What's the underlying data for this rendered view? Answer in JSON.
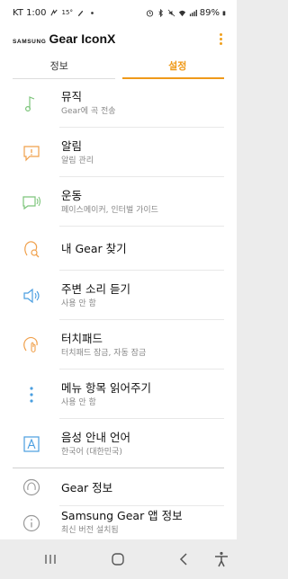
{
  "status": {
    "carrier_time": "KT 1:00",
    "temp": "15°",
    "battery": "89%"
  },
  "app": {
    "brand_small": "SAMSUNG",
    "brand_big": "Gear IconX"
  },
  "tabs": [
    {
      "label": "정보",
      "active": false
    },
    {
      "label": "설정",
      "active": true
    }
  ],
  "settings": [
    {
      "title": "뮤직",
      "subtitle": "Gear에 곡 전송",
      "icon": "music-note-icon"
    },
    {
      "title": "알림",
      "subtitle": "알림 관리",
      "icon": "notification-icon"
    },
    {
      "title": "운동",
      "subtitle": "페이스메이커, 인터벌 가이드",
      "icon": "workout-icon"
    },
    {
      "title": "내 Gear 찾기",
      "subtitle": "",
      "icon": "find-gear-icon"
    },
    {
      "title": "주변 소리 듣기",
      "subtitle": "사용 안 함",
      "icon": "ambient-sound-icon"
    },
    {
      "title": "터치패드",
      "subtitle": "터치패드 잠금, 자동 잠금",
      "icon": "touchpad-icon"
    },
    {
      "title": "메뉴 항목 읽어주기",
      "subtitle": "사용 안 함",
      "icon": "read-menu-icon"
    },
    {
      "title": "음성 안내 언어",
      "subtitle": "한국어 (대한민국)",
      "icon": "voice-language-icon"
    },
    {
      "title": "Gear 정보",
      "subtitle": "",
      "icon": "gear-info-icon"
    },
    {
      "title": "Samsung Gear 앱 정보",
      "subtitle": "최신 버전 설치됨",
      "icon": "app-info-icon"
    }
  ],
  "colors": {
    "accent": "#ef9a1a",
    "icon_green": "#7cc47a",
    "icon_orange": "#f0a04b",
    "icon_blue": "#4a9ee0",
    "icon_gray": "#999999"
  }
}
